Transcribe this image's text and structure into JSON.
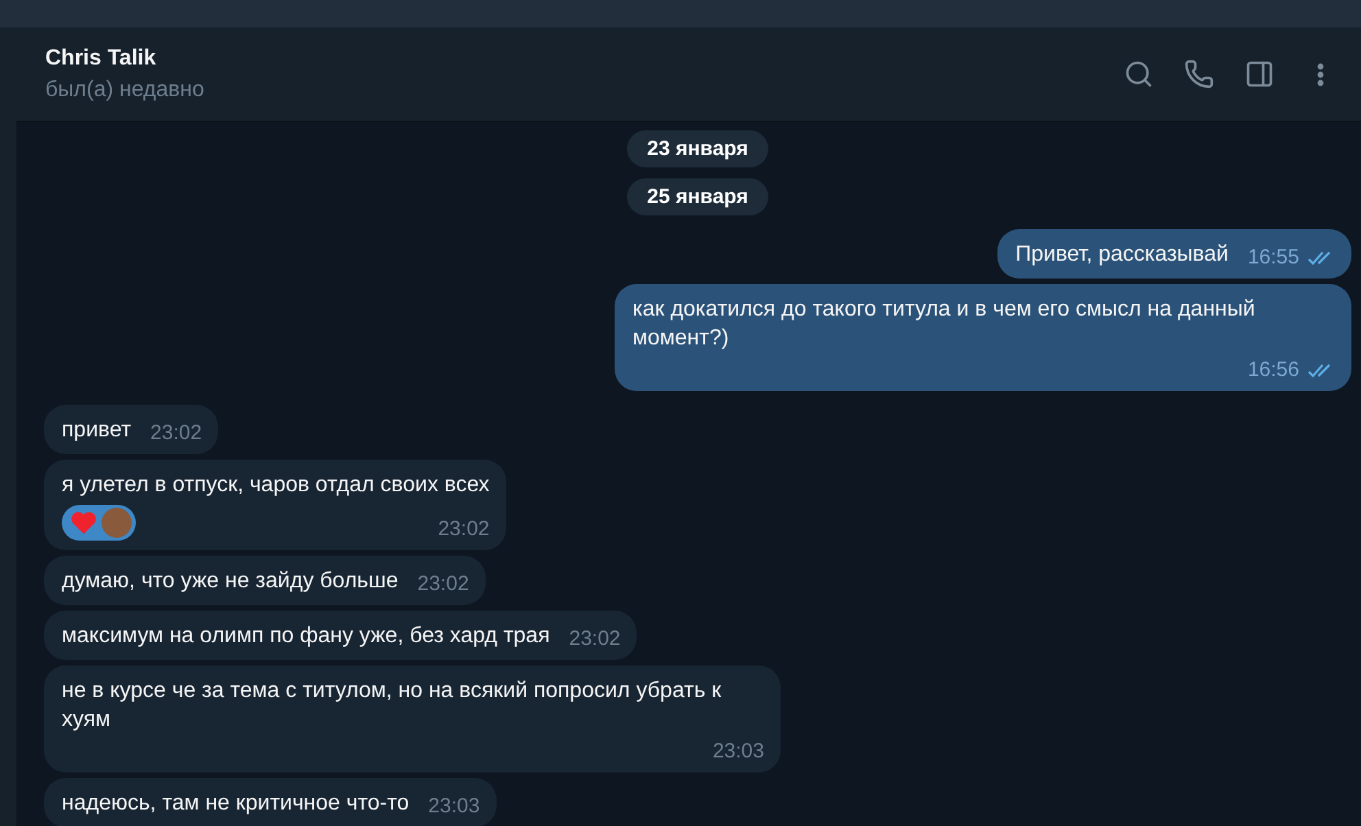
{
  "header": {
    "name": "Chris Talik",
    "status": "был(а) недавно"
  },
  "feed": [
    {
      "kind": "date",
      "text": "23 января"
    },
    {
      "kind": "date",
      "text": "25 января"
    },
    {
      "kind": "sent",
      "text": "Привет, рассказывай",
      "time": "16:55",
      "read": true
    },
    {
      "kind": "sent",
      "text": "как докатился до такого титула и в чем его смысл на данный момент?)",
      "time": "16:56",
      "read": true
    },
    {
      "kind": "received",
      "text": "привет",
      "time": "23:02"
    },
    {
      "kind": "received",
      "text": "я улетел в отпуск, чаров отдал своих всех",
      "time": "23:02",
      "reaction": {
        "selected": true
      }
    },
    {
      "kind": "received",
      "text": "думаю, что уже не зайду больше",
      "time": "23:02"
    },
    {
      "kind": "received",
      "text": "максимум на олимп по фану уже, без хард трая",
      "time": "23:02"
    },
    {
      "kind": "received",
      "text": "не в курсе че за тема с титулом, но на всякий попросил убрать к хуям",
      "time": "23:03"
    },
    {
      "kind": "received",
      "text": "надеюсь, там не критичное что-то",
      "time": "23:03"
    }
  ]
}
